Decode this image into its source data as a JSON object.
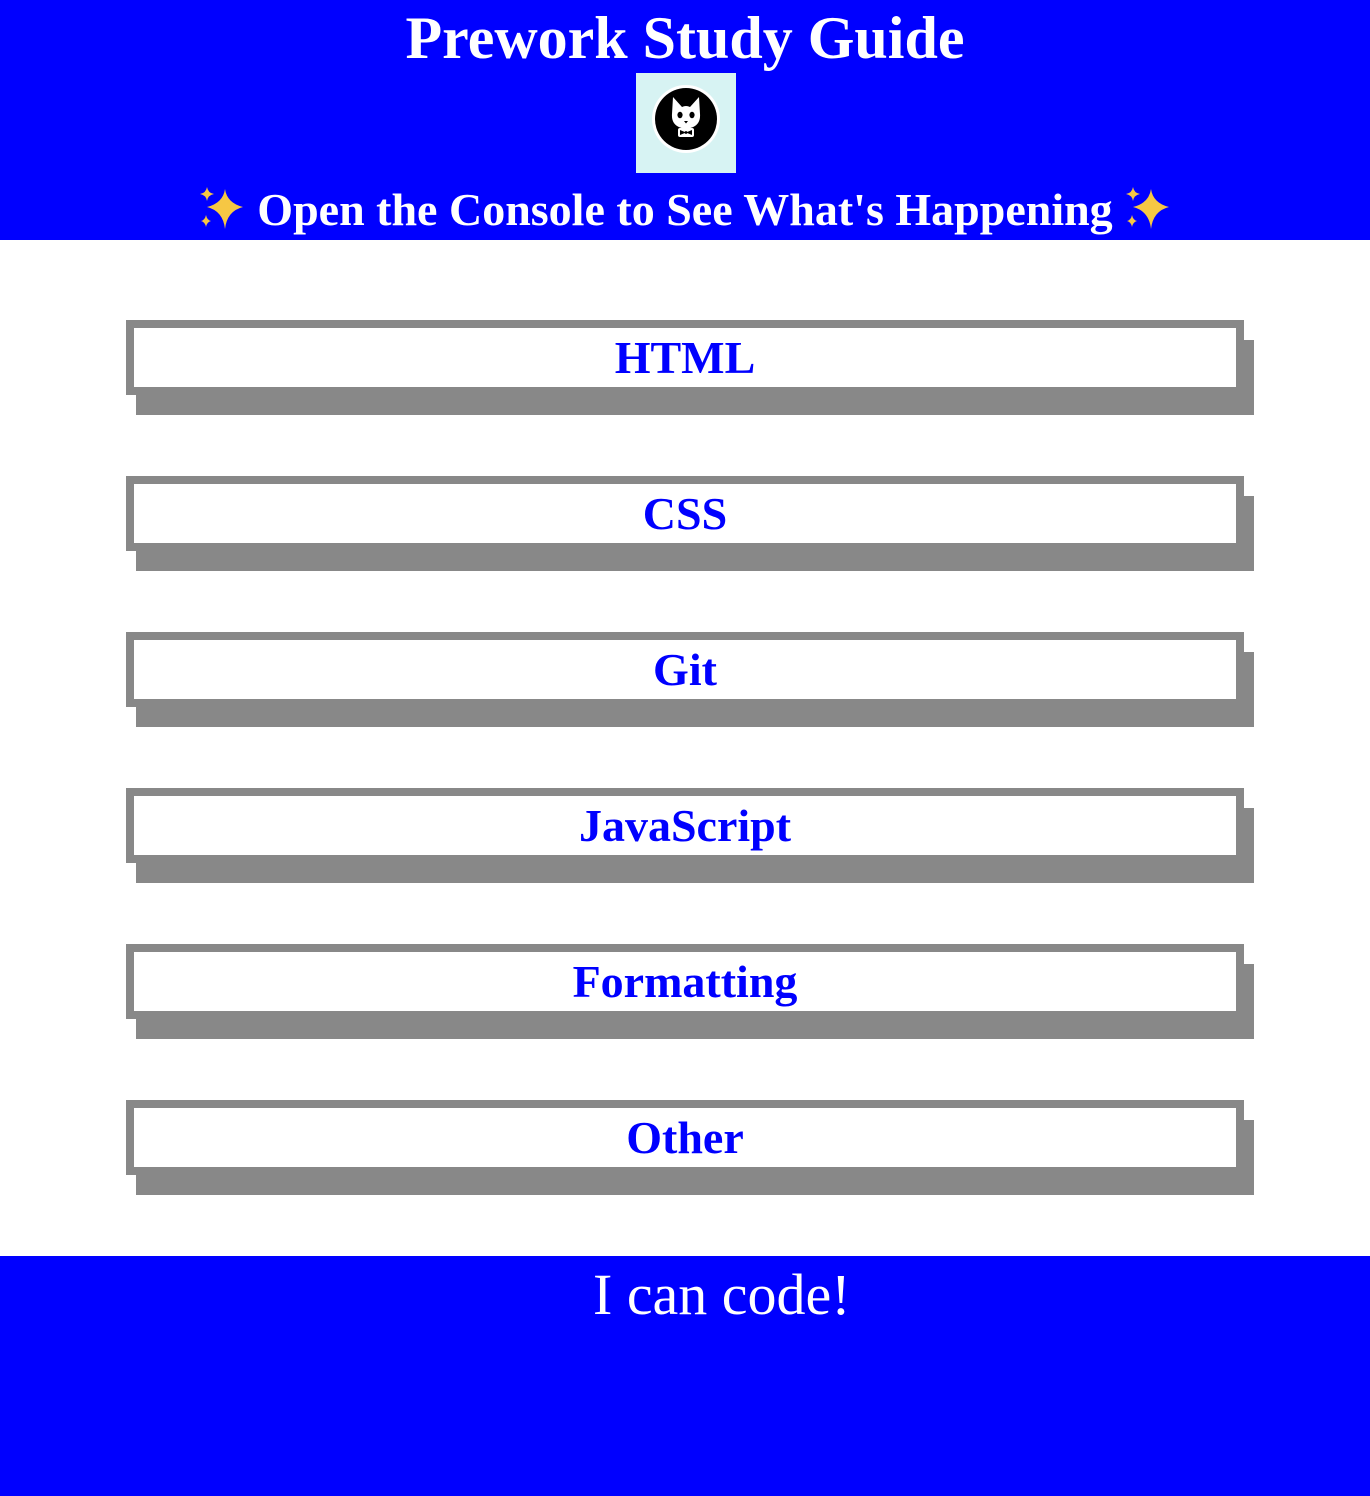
{
  "header": {
    "title": "Prework Study Guide",
    "subtitle": "Open the Console to See What's Happening",
    "logo_icon": "cat-logo-icon",
    "sparkle_icon": "sparkles-icon",
    "background_color": "#0000ff",
    "text_color": "#ffffff"
  },
  "topics": [
    {
      "label": "HTML"
    },
    {
      "label": "CSS"
    },
    {
      "label": "Git"
    },
    {
      "label": "JavaScript"
    },
    {
      "label": "Formatting"
    },
    {
      "label": "Other"
    }
  ],
  "topic_style": {
    "label_color": "#0000ff",
    "border_color": "#888888"
  },
  "footer": {
    "text": "I can code!"
  }
}
